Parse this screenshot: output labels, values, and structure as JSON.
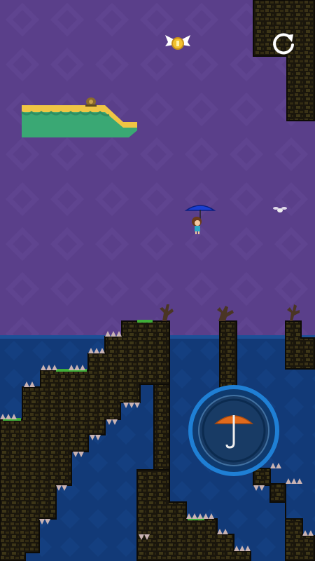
{
  "game": {
    "type": "side-scrolling platformer",
    "colors": {
      "sky": "#5a3f8a",
      "sky_pattern": "#654a97",
      "water": "#123a78",
      "water_surface": "#1d4f97",
      "rock": "#1a160c",
      "rock_brick": "#3d3617",
      "grass": "#3fae3a",
      "spike": "#c9b3b3",
      "floating_platform_top": "#f0c544",
      "floating_platform_body": "#3aa874",
      "umbrella_button_ring": "#1f7fd4",
      "umbrella_canopy": "#e06a1c",
      "restart_icon": "#ffffff"
    }
  },
  "hud": {
    "restart_icon": "restart-arrow-icon",
    "umbrella_icon": "umbrella-icon"
  },
  "sprites": {
    "player": "girl-with-blue-umbrella",
    "winged_coin": "winged-coin",
    "snail": "snail",
    "fly": "fly-enemy"
  }
}
